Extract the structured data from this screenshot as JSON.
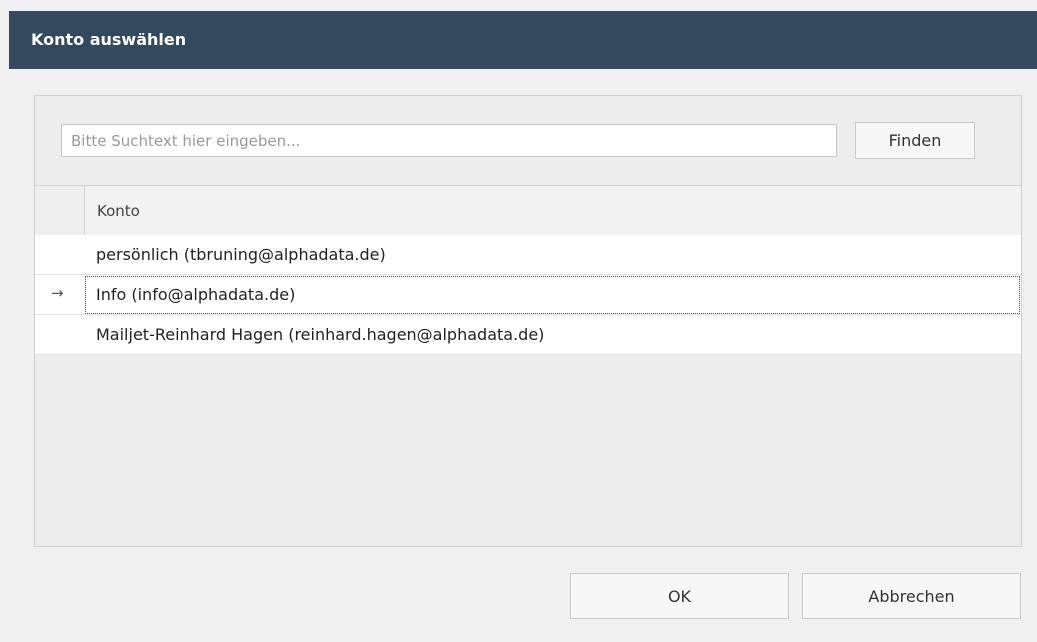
{
  "window": {
    "title": "Konto auswählen"
  },
  "search": {
    "placeholder": "Bitte Suchtext hier eingeben...",
    "value": "",
    "find_label": "Finden"
  },
  "grid": {
    "column_header": "Konto",
    "rows": [
      {
        "label": "persönlich (tbruning@alphadata.de)"
      },
      {
        "label": "Info (info@alphadata.de)",
        "indicator": "→",
        "selected": true
      },
      {
        "label": "Mailjet-Reinhard Hagen (reinhard.hagen@alphadata.de)"
      }
    ]
  },
  "buttons": {
    "ok_label": "OK",
    "cancel_label": "Abbrechen"
  },
  "colors": {
    "titlebar": "#34495e",
    "title_text": "#ffffff",
    "background": "#f0f0f0"
  }
}
